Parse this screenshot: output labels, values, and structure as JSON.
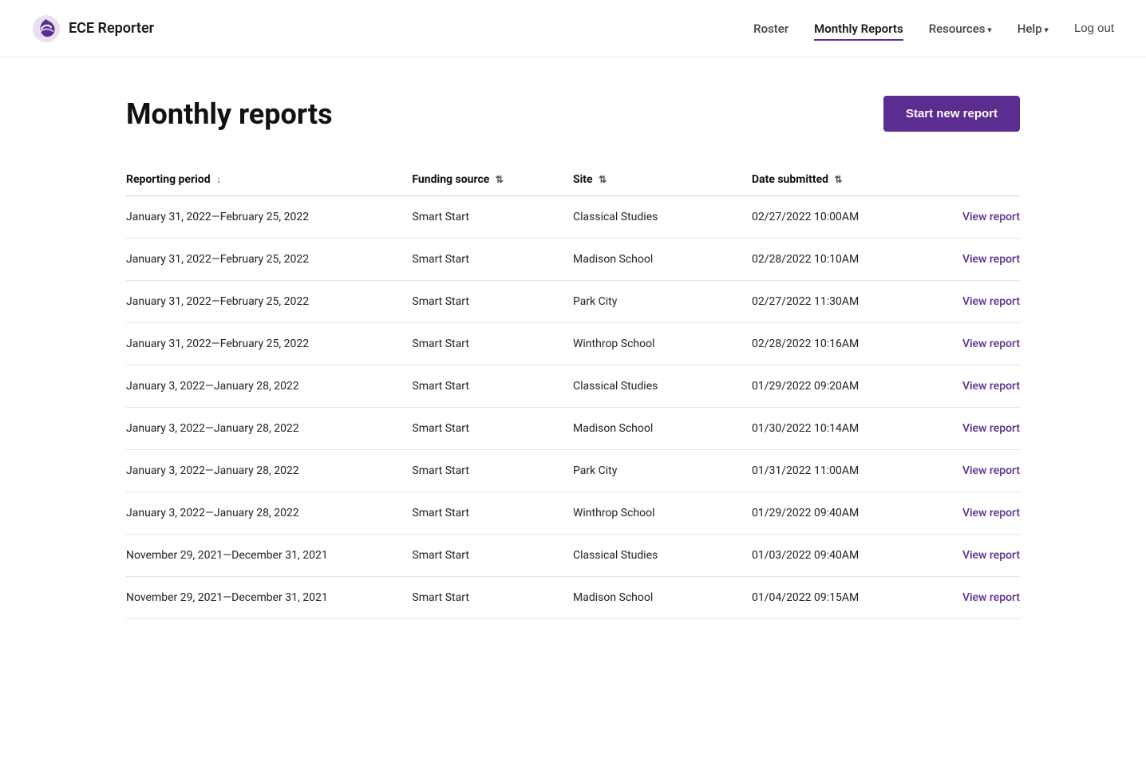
{
  "app": {
    "logo_text": "ECE Reporter"
  },
  "nav": {
    "links": [
      {
        "id": "roster",
        "label": "Roster",
        "active": false,
        "has_arrow": false
      },
      {
        "id": "monthly-reports",
        "label": "Monthly Reports",
        "active": true,
        "has_arrow": false
      },
      {
        "id": "resources",
        "label": "Resources",
        "active": false,
        "has_arrow": true
      },
      {
        "id": "help",
        "label": "Help",
        "active": false,
        "has_arrow": true
      }
    ],
    "logout_label": "Log out"
  },
  "page": {
    "title": "Monthly reports",
    "start_button": "Start new report"
  },
  "table": {
    "columns": [
      {
        "id": "period",
        "label": "Reporting period",
        "sortable": true,
        "sort_icon": "↓"
      },
      {
        "id": "funding",
        "label": "Funding source",
        "sortable": true,
        "sort_icon": "⇅"
      },
      {
        "id": "site",
        "label": "Site",
        "sortable": true,
        "sort_icon": "⇅"
      },
      {
        "id": "date",
        "label": "Date submitted",
        "sortable": true,
        "sort_icon": "⇅"
      },
      {
        "id": "action",
        "label": "",
        "sortable": false
      }
    ],
    "rows": [
      {
        "period": "January 31, 2022—February 25, 2022",
        "funding": "Smart Start",
        "site": "Classical Studies",
        "date": "02/27/2022 10:00AM",
        "action": "View report"
      },
      {
        "period": "January 31, 2022—February 25, 2022",
        "funding": "Smart Start",
        "site": "Madison School",
        "date": "02/28/2022 10:10AM",
        "action": "View report"
      },
      {
        "period": "January 31, 2022—February 25, 2022",
        "funding": "Smart Start",
        "site": "Park City",
        "date": "02/27/2022 11:30AM",
        "action": "View report"
      },
      {
        "period": "January 31, 2022—February 25, 2022",
        "funding": "Smart Start",
        "site": "Winthrop School",
        "date": "02/28/2022 10:16AM",
        "action": "View report"
      },
      {
        "period": "January 3, 2022—January 28, 2022",
        "funding": "Smart Start",
        "site": "Classical Studies",
        "date": "01/29/2022 09:20AM",
        "action": "View report"
      },
      {
        "period": "January 3, 2022—January 28, 2022",
        "funding": "Smart Start",
        "site": "Madison School",
        "date": "01/30/2022 10:14AM",
        "action": "View report"
      },
      {
        "period": "January 3, 2022—January 28, 2022",
        "funding": "Smart Start",
        "site": "Park City",
        "date": "01/31/2022 11:00AM",
        "action": "View report"
      },
      {
        "period": "January 3, 2022—January 28, 2022",
        "funding": "Smart Start",
        "site": "Winthrop School",
        "date": "01/29/2022 09:40AM",
        "action": "View report"
      },
      {
        "period": "November 29, 2021—December 31, 2021",
        "funding": "Smart Start",
        "site": "Classical Studies",
        "date": "01/03/2022 09:40AM",
        "action": "View report"
      },
      {
        "period": "November 29, 2021—December 31, 2021",
        "funding": "Smart Start",
        "site": "Madison School",
        "date": "01/04/2022 09:15AM",
        "action": "View report"
      }
    ]
  }
}
